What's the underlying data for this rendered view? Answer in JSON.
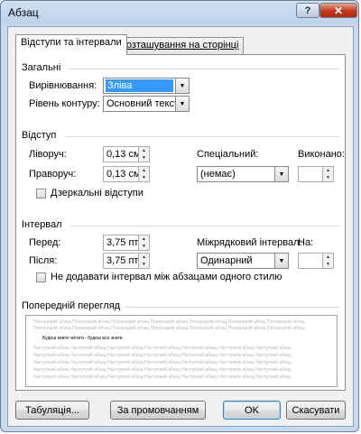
{
  "window": {
    "title": "Абзац",
    "help_glyph": "?",
    "close_glyph": "✕"
  },
  "tabs": [
    {
      "label": "Відступи та інтервали",
      "active": true
    },
    {
      "label": "Розташування на сторінці",
      "active": false
    }
  ],
  "general": {
    "title": "Загальні",
    "alignment_label": "Вирівнювання:",
    "alignment_value": "Зліва",
    "outline_label": "Рівень контуру:",
    "outline_value": "Основний текст"
  },
  "indent": {
    "title": "Відступ",
    "left_label": "Ліворуч:",
    "left_value": "0,13 см",
    "right_label": "Праворуч:",
    "right_value": "0,13 см",
    "special_label": "Спеціальний:",
    "special_value": "(немає)",
    "by_label": "Виконано:",
    "by_value": "",
    "mirror_label": "Дзеркальні відступи"
  },
  "spacing": {
    "title": "Інтервал",
    "before_label": "Перед:",
    "before_value": "3,75 пт",
    "after_label": "Після:",
    "after_value": "3,75 пт",
    "line_label": "Міжрядковий інтервал:",
    "line_value": "Одинарний",
    "at_label": "На:",
    "at_value": "",
    "no_space_label": "Не додавати інтервал між абзацами одного стилю"
  },
  "preview": {
    "title": "Попередній перегляд",
    "prev_lines": [
      "Попередній абзац Попередній абзац Попередній абзац Попередній абзац Попередній абзац Попередній абзац Попередній абзац",
      "Попередній абзац Попередній абзац Попередній абзац Попередній абзац Попередній абзац Попередній абзац Попередній абзац"
    ],
    "current_line": "Будеш книги читати - будеш все знати.",
    "next_lines": [
      "Наступний абзац Наступний абзац Наступний абзац Наступний абзац Наступний абзац Наступний абзац Наступний абзац",
      "Наступний абзац Наступний абзац Наступний абзац Наступний абзац Наступний абзац Наступний абзац Наступний абзац",
      "Наступний абзац Наступний абзац Наступний абзац Наступний абзац Наступний абзац Наступний абзац Наступний абзац",
      "Наступний абзац Наступний абзац Наступний абзац Наступний абзац Наступний абзац Наступний абзац Наступний абзац",
      "Наступний абзац Наступний абзац Наступний абзац Наступний абзац Наступний абзац Наступний абзац Наступний абзац"
    ]
  },
  "buttons": {
    "tabs": "Табуляція...",
    "default": "За промовчанням",
    "ok": "OK",
    "cancel": "Скасувати"
  },
  "icons": {
    "dropdown": "▼",
    "spin_up": "▲",
    "spin_down": "▼"
  }
}
